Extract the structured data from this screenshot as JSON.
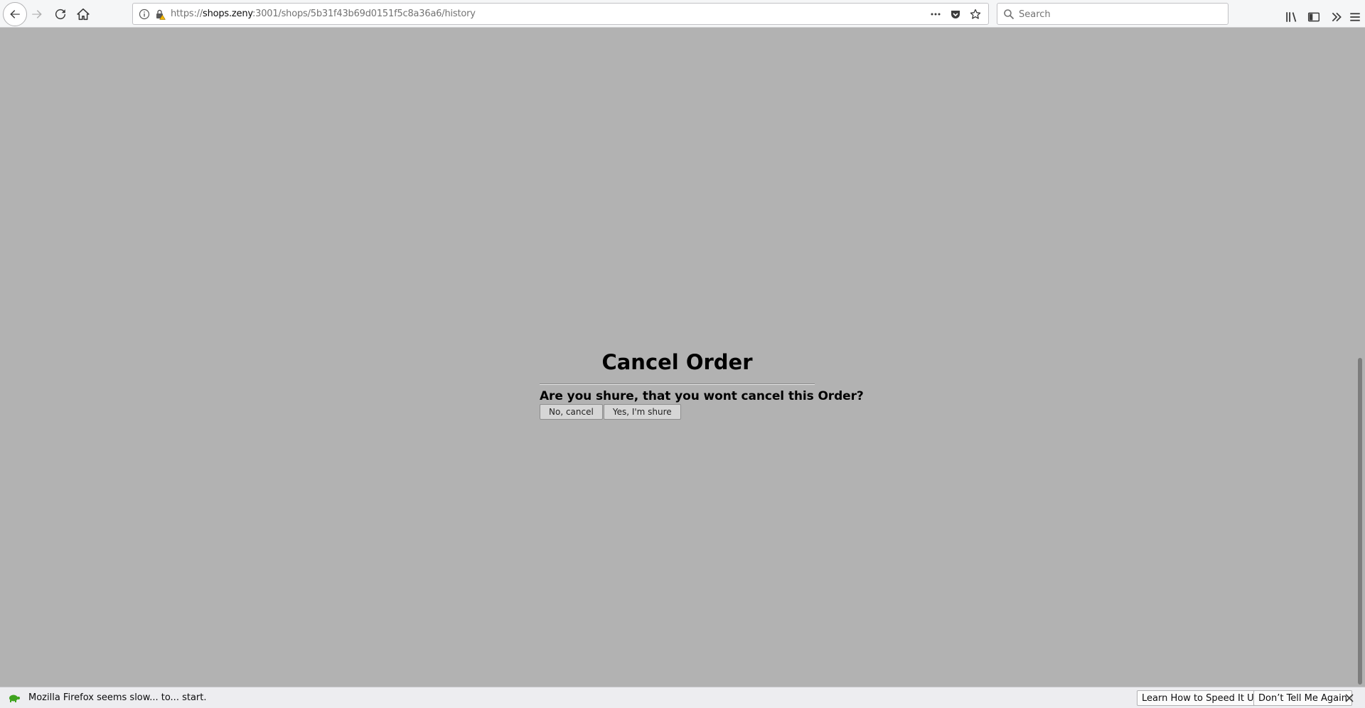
{
  "browser": {
    "url_scheme": "https://",
    "url_host": "shops.zeny",
    "url_rest": ":3001/shops/5b31f43b69d0151f5c8a36a6/history",
    "search_placeholder": "Search"
  },
  "dialog": {
    "title": "Cancel Order",
    "question": "Are you shure, that you wont cancel this Order?",
    "no_button": "No, cancel",
    "yes_button": "Yes, I'm shure"
  },
  "notification": {
    "message": "Mozilla Firefox seems slow... to... start.",
    "learn_button": "Learn How to Speed It Up",
    "dont_button": "Don’t Tell Me Again"
  },
  "colors": {
    "page_background": "#b2b2b2",
    "toolbar_background": "#f5f6f7"
  }
}
